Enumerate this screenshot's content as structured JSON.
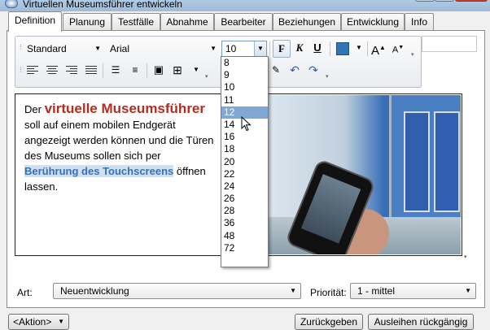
{
  "window": {
    "title": "Virtuellen Museumsführer entwickeln"
  },
  "tabs": [
    {
      "label": "Definition",
      "active": true
    },
    {
      "label": "Planung"
    },
    {
      "label": "Testfälle"
    },
    {
      "label": "Abnahme"
    },
    {
      "label": "Bearbeiter"
    },
    {
      "label": "Beziehungen"
    },
    {
      "label": "Entwicklung"
    },
    {
      "label": "Info"
    }
  ],
  "toolbar": {
    "style_value": "Standard",
    "font_value": "Arial",
    "font_size_value": "10",
    "bold_label": "F",
    "italic_label": "K",
    "underline_label": "U",
    "accent_color": "#2f74b5",
    "grow_font_label": "A",
    "shrink_font_label": "A"
  },
  "font_size_options": [
    "8",
    "9",
    "10",
    "11",
    "12",
    "14",
    "16",
    "18",
    "20",
    "22",
    "24",
    "26",
    "28",
    "36",
    "48",
    "72"
  ],
  "font_size_highlighted": "12",
  "editor": {
    "line1_prefix": "Der ",
    "line1_highlight": "virtuelle Museumsführer",
    "line2": "soll auf einem mobilen Endgerät",
    "line3": "angezeigt werden können und die Türen",
    "line4": "des Museums sollen sich per",
    "line5_highlight": "Berührung des Touchscreens",
    "line5_suffix": " öffnen",
    "line6": "lassen."
  },
  "fields": {
    "art_label": "Art:",
    "art_value": "Neuentwicklung",
    "priority_label": "Priorität:",
    "priority_value": "1 - mittel"
  },
  "footer": {
    "action_label": "<Aktion>",
    "return_label": "Zurückgeben",
    "undo_borrow_label": "Ausleihen rückgängig"
  }
}
